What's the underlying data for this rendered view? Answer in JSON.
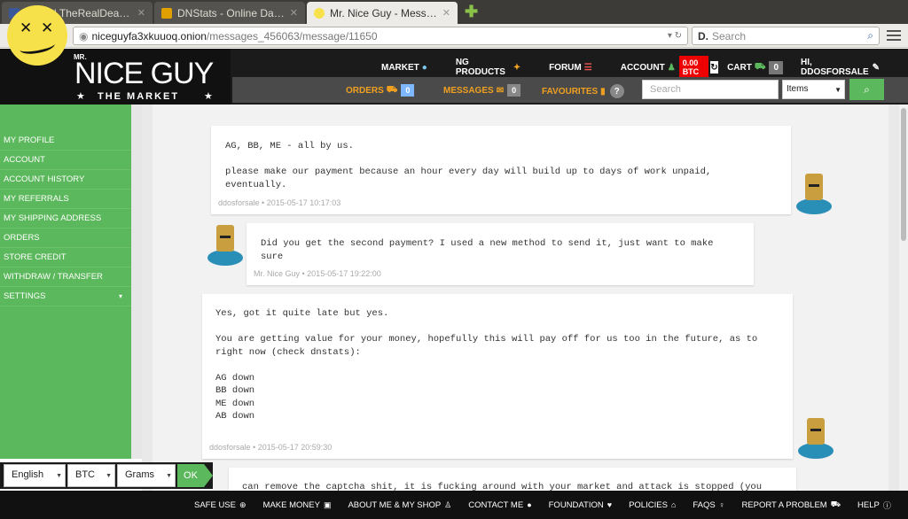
{
  "browser": {
    "tabs": [
      {
        "title": "Inbox | TheRealDeal ...",
        "favicon_color": "#3b5998",
        "active": false
      },
      {
        "title": "DNStats - Online Dar...",
        "favicon_color": "#e0a000",
        "active": false
      },
      {
        "title": "Mr. Nice Guy - Messa...",
        "favicon_color": "#f7e14b",
        "active": true
      }
    ],
    "new_tab_icon": "plus-icon",
    "url_host": "niceguyfa3xkuuoq.onion",
    "url_path": "/messages_456063/message/11650",
    "search_placeholder": "Search"
  },
  "site": {
    "brand_mr": "MR.",
    "brand_main": "NICE GUY",
    "brand_sub": "THE MARKET",
    "top_nav": {
      "market": "MARKET",
      "ng_products": "NG PRODUCTS",
      "forum": "FORUM",
      "account": "ACCOUNT",
      "balance": "0.00 BTC",
      "cart": "CART",
      "cart_count": "0",
      "greeting": "HI, DDOSFORSALE"
    },
    "sub_nav": {
      "orders": "ORDERS",
      "orders_count": "0",
      "messages": "MESSAGES",
      "messages_count": "0",
      "favourites": "FAVOURITES",
      "favourites_badge": "?"
    },
    "search_placeholder": "Search",
    "search_category": "Items"
  },
  "sidebar": {
    "items": [
      {
        "label": "MY PROFILE"
      },
      {
        "label": "ACCOUNT"
      },
      {
        "label": "ACCOUNT HISTORY"
      },
      {
        "label": "MY REFERRALS"
      },
      {
        "label": "MY SHIPPING ADDRESS"
      },
      {
        "label": "ORDERS"
      },
      {
        "label": "STORE CREDIT"
      },
      {
        "label": "WITHDRAW / TRANSFER"
      },
      {
        "label": "SETTINGS"
      }
    ]
  },
  "messages": [
    {
      "text": "AG, BB, ME - all by us.\n\nplease make our payment because an hour every day will build up to days of work unpaid, eventually.",
      "author": "ddosforsale",
      "time": "2015-05-17 10:17:03"
    },
    {
      "text": "Did you get the second payment? I used a new method to send it, just want to make sure",
      "author": "Mr. Nice Guy",
      "time": "2015-05-17 19:22:00"
    },
    {
      "text": "Yes, got it quite late but yes.\n\nYou are getting value for your money, hopefully this will pay off for us too in the future, as to\nright now (check dnstats):\n\nAG down\nBB down\nME down\nAB down",
      "author": "ddosforsale",
      "time": "2015-05-17 20:59:30"
    },
    {
      "text": "can remove the captcha shit, it is fucking around with your market and attack is stopped (you"
    }
  ],
  "preferences": {
    "language": "English",
    "currency": "BTC",
    "unit": "Grams",
    "ok_label": "OK"
  },
  "footer": {
    "links": [
      {
        "label": "SAFE USE",
        "icon": "lifebuoy-icon"
      },
      {
        "label": "MAKE MONEY",
        "icon": "money-icon"
      },
      {
        "label": "ABOUT ME & MY SHOP",
        "icon": "person-icon"
      },
      {
        "label": "CONTACT ME",
        "icon": "chat-icon"
      },
      {
        "label": "FOUNDATION",
        "icon": "heart-icon"
      },
      {
        "label": "POLICIES",
        "icon": "bank-icon"
      },
      {
        "label": "FAQS",
        "icon": "bulb-icon"
      },
      {
        "label": "REPORT A PROBLEM",
        "icon": "truck-icon"
      },
      {
        "label": "HELP",
        "icon": "info-icon"
      }
    ]
  },
  "colors": {
    "accent_green": "#5cb85c",
    "header_dark": "#1b1b1b",
    "orange_nav": "#f0a020",
    "balance_red": "#ee0000",
    "smiley_yellow": "#f7e14b"
  }
}
